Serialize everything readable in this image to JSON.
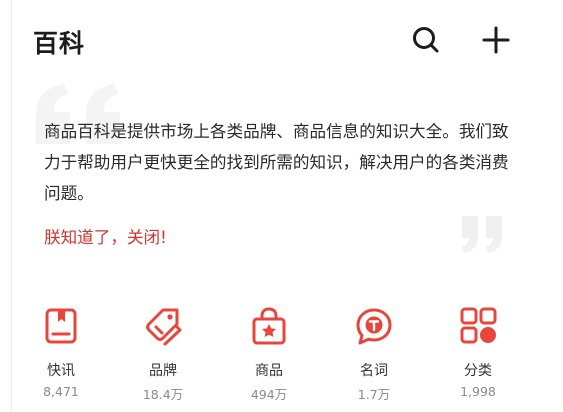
{
  "header": {
    "title": "百科"
  },
  "icons": {
    "search": "search-icon",
    "add": "plus-icon"
  },
  "colors": {
    "accent": "#e8453c",
    "link": "#d0342c",
    "quote": "#f4f4f4"
  },
  "intro": {
    "text": "商品百科是提供市场上各类品牌、商品信息的知识大全。我们致力于帮助用户更快更全的找到所需的知识，解决用户的各类消费问题。",
    "dismiss": "朕知道了，关闭!"
  },
  "stats": [
    {
      "icon": "news-icon",
      "label": "快讯",
      "count": "8,471"
    },
    {
      "icon": "brand-tag-icon",
      "label": "品牌",
      "count": "18.4万"
    },
    {
      "icon": "shopping-bag-icon",
      "label": "商品",
      "count": "494万"
    },
    {
      "icon": "term-bubble-icon",
      "label": "名词",
      "count": "1.7万"
    },
    {
      "icon": "category-grid-icon",
      "label": "分类",
      "count": "1,998"
    }
  ]
}
